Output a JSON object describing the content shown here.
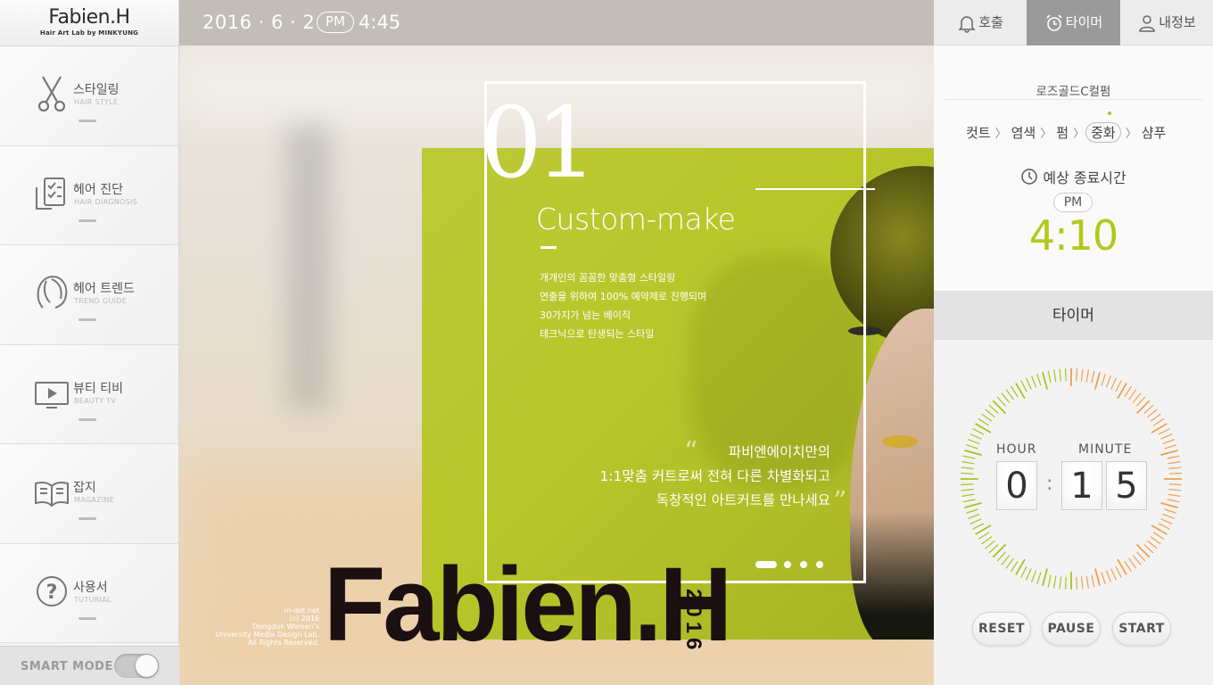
{
  "logo": {
    "title": "Fabien.H",
    "subtitle": "Hair Art Lab by MINKYUNG"
  },
  "nav": [
    {
      "label": "스타일링",
      "sub": "HAIR STYLE",
      "icon": "scissors-icon"
    },
    {
      "label": "헤어 진단",
      "sub": "HAIR DIAGNOSIS",
      "icon": "checklist-icon"
    },
    {
      "label": "헤어 트렌드",
      "sub": "TREND GUIDE",
      "icon": "hair-head-icon"
    },
    {
      "label": "뷰티 티비",
      "sub": "BEAUTY TV",
      "icon": "tv-play-icon"
    },
    {
      "label": "잡지",
      "sub": "MAGAZINE",
      "icon": "book-icon"
    },
    {
      "label": "사용서",
      "sub": "TUTURIAL",
      "icon": "question-icon"
    }
  ],
  "smart_mode": {
    "label": "SMART MODE",
    "on": true
  },
  "topbar": {
    "date": "2016 · 6 · 2",
    "ampm": "PM",
    "time": "4:45"
  },
  "feature": {
    "number": "01",
    "title": "Custom-make",
    "desc": [
      "개개인의 꼼꼼한 맞춤형 스타일링",
      "연출을 위하여 100% 예약제로 진행되며",
      "30가지가 넘는 베이직",
      "테크닉으로 탄생되는 스타일"
    ],
    "quote": [
      "파비엔에이치만의",
      "1:1맞춤 커트로써 전혀 다른 차별화되고",
      "독창적인 아트커트를 만나세요"
    ],
    "quote_open": "“",
    "quote_close": "”",
    "slides": 4,
    "active_slide": 0
  },
  "brand": {
    "name": "Fabien.H",
    "year": "2016"
  },
  "credit": [
    "m-dot.net",
    "(c) 2016",
    "Dongduk Women's",
    "University Media Design Lab.",
    "All Rights Reserved."
  ],
  "right_tabs": [
    {
      "label": "호출",
      "icon": "bell-icon",
      "active": false
    },
    {
      "label": "타이머",
      "icon": "alarm-clock-icon",
      "active": true
    },
    {
      "label": "내정보",
      "icon": "user-icon",
      "active": false
    }
  ],
  "service": {
    "style_name": "로즈골드C컬펌",
    "steps": [
      "컷트",
      "염색",
      "펌",
      "중화",
      "샴푸"
    ],
    "current_step": 3,
    "eta_label": "예상 종료시간",
    "eta_ampm": "PM",
    "eta_time": "4:10"
  },
  "timer": {
    "title": "타이머",
    "hour_label": "HOUR",
    "minute_label": "MINUTE",
    "hour_digit": "0",
    "minute_digits": [
      "1",
      "5"
    ],
    "buttons": {
      "reset": "RESET",
      "pause": "PAUSE",
      "start": "START"
    },
    "colors": {
      "green": "#a8c21f",
      "orange": "#f0a050"
    }
  },
  "colors": {
    "accent_green": "#b3c81c",
    "feature_green": "#b8c62a",
    "brand_dark": "#1b0f12"
  }
}
